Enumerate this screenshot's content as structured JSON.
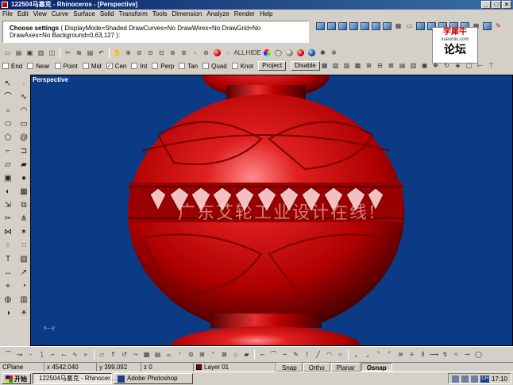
{
  "window": {
    "title": "122504马塞克 - Rhinoceros - [Perspective]",
    "buttons": [
      "_",
      "□",
      "×"
    ]
  },
  "menu": [
    "File",
    "Edit",
    "View",
    "Curve",
    "Surface",
    "Solid",
    "Transform",
    "Tools",
    "Dimension",
    "Analyze",
    "Render",
    "Help"
  ],
  "command": {
    "label": "Choose settings",
    "line1_rest": " ( DisplayMode=Shaded  DrawCurves=No  DrawWires=No  DrawGrid=No",
    "line2": "DrawAxes=No  Background=0,63,127 ):"
  },
  "osnap": {
    "items": [
      {
        "label": "End",
        "checked": false
      },
      {
        "label": "Near",
        "checked": false
      },
      {
        "label": "Point",
        "checked": false
      },
      {
        "label": "Mid",
        "checked": false
      },
      {
        "label": "Cen",
        "checked": true
      },
      {
        "label": "Int",
        "checked": false
      },
      {
        "label": "Perp",
        "checked": false
      },
      {
        "label": "Tan",
        "checked": false
      },
      {
        "label": "Quad",
        "checked": false
      },
      {
        "label": "Knot",
        "checked": false
      }
    ],
    "project_label": "Project",
    "disable_label": "Disable"
  },
  "standard_toolbar_labels": {
    "all": "ALL",
    "hide": "HIDE"
  },
  "viewport": {
    "title": "Perspective",
    "axis_label": "x—y",
    "background_color": "#003f7f",
    "object_color": "#cc0000",
    "watermark": "广东艾轮工业设计在线!"
  },
  "logo": {
    "line1": "学犀牛",
    "line2": "xuexiniu.com",
    "line3": "论坛"
  },
  "status": {
    "cplane": "CPlane",
    "x": "x 4542.040",
    "y": "y 399.092",
    "z": "z 0",
    "layer": "Layer 01",
    "panes": [
      "Snap",
      "Ortho",
      "Planar",
      "Osnap"
    ]
  },
  "taskbar": {
    "start_label": "开始",
    "tasks": [
      "122504马塞克 - Rhinocer...",
      "Adobe Photoshop"
    ],
    "tray_lang": "CH",
    "clock": "17:10"
  }
}
